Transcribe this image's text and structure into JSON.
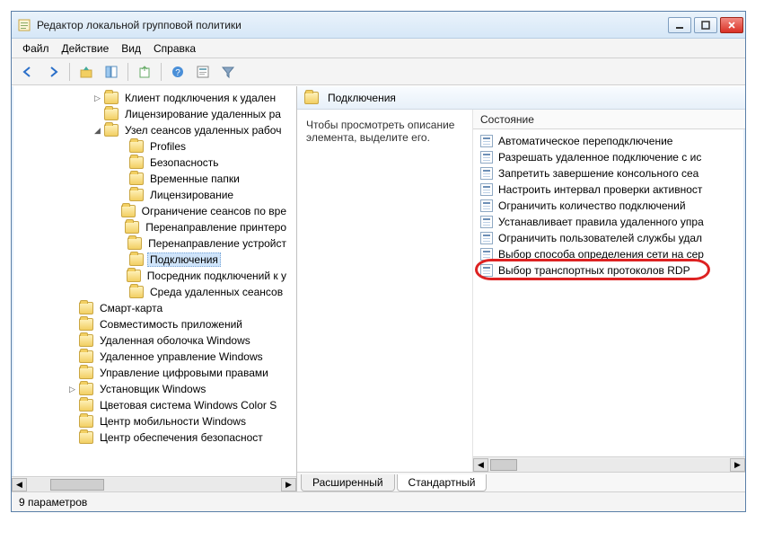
{
  "window": {
    "title": "Редактор локальной групповой политики"
  },
  "menu": {
    "file": "Файл",
    "action": "Действие",
    "view": "Вид",
    "help": "Справка"
  },
  "toolbar": {
    "back": "back",
    "forward": "forward",
    "up": "up",
    "show": "show",
    "refresh": "refresh",
    "export": "export",
    "help": "help",
    "props": "props",
    "filter": "filter"
  },
  "tree": {
    "items": [
      {
        "indent": 90,
        "toggle": "▷",
        "label": "Клиент подключения к удален"
      },
      {
        "indent": 90,
        "toggle": "",
        "label": "Лицензирование удаленных ра"
      },
      {
        "indent": 90,
        "toggle": "◢",
        "label": "Узел сеансов удаленных рабоч"
      },
      {
        "indent": 118,
        "toggle": "",
        "label": "Profiles"
      },
      {
        "indent": 118,
        "toggle": "",
        "label": "Безопасность"
      },
      {
        "indent": 118,
        "toggle": "",
        "label": "Временные папки"
      },
      {
        "indent": 118,
        "toggle": "",
        "label": "Лицензирование"
      },
      {
        "indent": 118,
        "toggle": "",
        "label": "Ограничение сеансов по вре"
      },
      {
        "indent": 118,
        "toggle": "",
        "label": "Перенаправление принтеро"
      },
      {
        "indent": 118,
        "toggle": "",
        "label": "Перенаправление устройст"
      },
      {
        "indent": 118,
        "toggle": "",
        "label": "Подключения",
        "selected": true
      },
      {
        "indent": 118,
        "toggle": "",
        "label": "Посредник подключений к у"
      },
      {
        "indent": 118,
        "toggle": "",
        "label": "Среда удаленных сеансов"
      },
      {
        "indent": 62,
        "toggle": "",
        "label": "Смарт-карта"
      },
      {
        "indent": 62,
        "toggle": "",
        "label": "Совместимость приложений"
      },
      {
        "indent": 62,
        "toggle": "",
        "label": "Удаленная оболочка Windows"
      },
      {
        "indent": 62,
        "toggle": "",
        "label": "Удаленное управление Windows"
      },
      {
        "indent": 62,
        "toggle": "",
        "label": "Управление цифровыми правами"
      },
      {
        "indent": 62,
        "toggle": "▷",
        "label": "Установщик Windows"
      },
      {
        "indent": 62,
        "toggle": "",
        "label": "Цветовая система Windows Color S"
      },
      {
        "indent": 62,
        "toggle": "",
        "label": "Центр мобильности Windows"
      },
      {
        "indent": 62,
        "toggle": "",
        "label": "Центр обеспечения безопасност"
      }
    ]
  },
  "right": {
    "header": "Подключения",
    "description": "Чтобы просмотреть описание элемента, выделите его.",
    "column": "Состояние",
    "items": [
      "Автоматическое переподключение",
      "Разрешать удаленное подключение с ис",
      "Запретить завершение консольного сеа",
      "Настроить интервал проверки активност",
      "Ограничить количество подключений",
      "Устанавливает правила удаленного упра",
      "Ограничить пользователей службы удал",
      "Выбор способа определения сети на сер",
      "Выбор транспортных протоколов RDP"
    ],
    "highlighted_index": 8,
    "tabs": {
      "extended": "Расширенный",
      "standard": "Стандартный"
    }
  },
  "status": {
    "text": "9 параметров"
  }
}
